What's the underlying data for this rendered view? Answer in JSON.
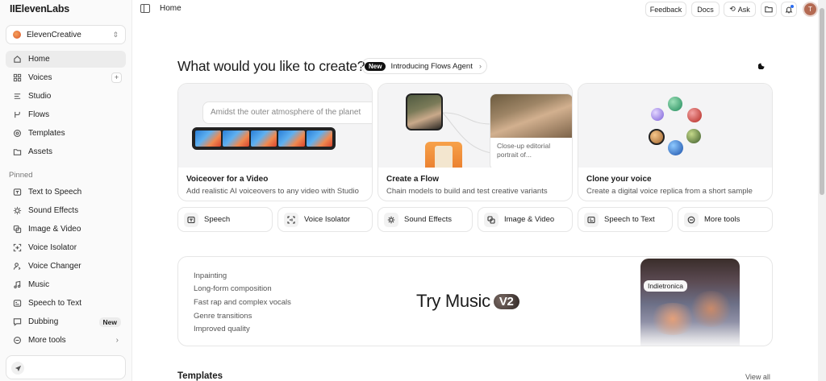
{
  "app": {
    "logo": "IIElevenLabs"
  },
  "workspace": {
    "name": "ElevenCreative"
  },
  "nav": {
    "home": "Home",
    "voices": "Voices",
    "studio": "Studio",
    "flows": "Flows",
    "templates": "Templates",
    "assets": "Assets"
  },
  "pinned": {
    "label": "Pinned",
    "items": [
      "Text to Speech",
      "Sound Effects",
      "Image & Video",
      "Voice Isolator",
      "Voice Changer",
      "Music",
      "Speech to Text",
      "Dubbing",
      "More tools"
    ],
    "dubbing_badge": "New"
  },
  "topbar": {
    "breadcrumb": "Home",
    "feedback": "Feedback",
    "docs": "Docs",
    "ask": "Ask",
    "avatar_initial": "T"
  },
  "main": {
    "headline": "What would you like to create?",
    "pill_badge": "New",
    "pill_text": "Introducing Flows Agent"
  },
  "cards": [
    {
      "title": "Voiceover for a Video",
      "desc": "Add realistic AI voiceovers to any video with Studio",
      "prompt": "Amidst the outer atmosphere of the planet"
    },
    {
      "title": "Create a Flow",
      "desc": "Chain models to build and test creative variants",
      "caption": "Close-up editorial portrait of..."
    },
    {
      "title": "Clone your voice",
      "desc": "Create a digital voice replica from a short sample"
    }
  ],
  "tools": [
    "Speech",
    "Voice Isolator",
    "Sound Effects",
    "Image & Video",
    "Speech to Text",
    "More tools"
  ],
  "banner": {
    "features": [
      "Inpainting",
      "Long-form composition",
      "Fast rap and complex vocals",
      "Genre transitions",
      "Improved quality"
    ],
    "title": "Try Music",
    "version": "V2",
    "tag": "Indietronica"
  },
  "sections": {
    "templates": "Templates",
    "view_all": "View all"
  },
  "colors": {
    "accent": "#111111",
    "avatar": "#b46a52"
  }
}
